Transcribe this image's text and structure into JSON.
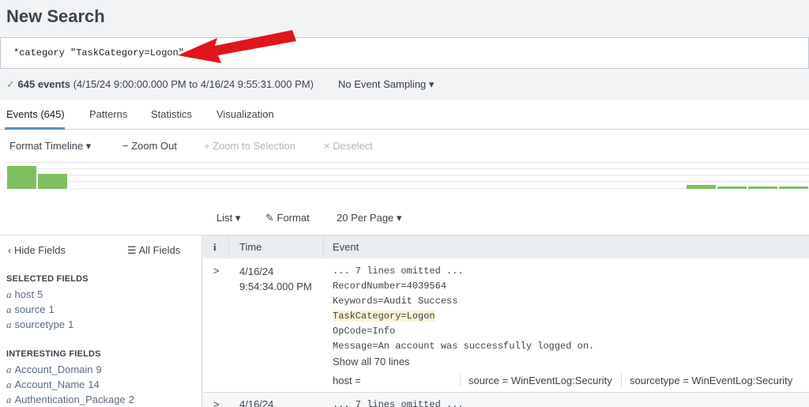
{
  "page": {
    "title": "New Search"
  },
  "search": {
    "query": "*category \"TaskCategory=Logon\""
  },
  "status": {
    "check": "✓",
    "count_label": "645 events",
    "range": "(4/15/24 9:00:00.000 PM to 4/16/24 9:55:31.000 PM)",
    "sampling": "No Event Sampling ▾"
  },
  "tabs": [
    {
      "label": "Events (645)",
      "active": true
    },
    {
      "label": "Patterns"
    },
    {
      "label": "Statistics"
    },
    {
      "label": "Visualization"
    }
  ],
  "timeline": {
    "format": "Format Timeline ▾",
    "zoom_out": "− Zoom Out",
    "zoom_selection": "+ Zoom to Selection",
    "deselect": "× Deselect",
    "bars": [
      0.85,
      0.55,
      0,
      0,
      0,
      0,
      0,
      0,
      0,
      0,
      0,
      0,
      0,
      0,
      0,
      0,
      0,
      0,
      0,
      0,
      0,
      0,
      0.15,
      0.08,
      0.08,
      0.08
    ],
    "bar_color": "#7fc05e"
  },
  "results_toolbar": {
    "list": "List ▾",
    "format": "Format",
    "per_page": "20 Per Page ▾"
  },
  "sidebar": {
    "hide_fields": "Hide Fields",
    "all_fields": "All Fields",
    "selected_heading": "SELECTED FIELDS",
    "selected": [
      {
        "type": "a",
        "name": "host",
        "count": "5"
      },
      {
        "type": "a",
        "name": "source",
        "count": "1"
      },
      {
        "type": "a",
        "name": "sourcetype",
        "count": "1"
      }
    ],
    "interesting_heading": "INTERESTING FIELDS",
    "interesting": [
      {
        "type": "a",
        "name": "Account_Domain",
        "count": "9"
      },
      {
        "type": "a",
        "name": "Account_Name",
        "count": "14"
      },
      {
        "type": "a",
        "name": "Authentication_Package",
        "count": "2"
      }
    ]
  },
  "table": {
    "headers": {
      "info": "i",
      "time": "Time",
      "event": "Event"
    },
    "rows": [
      {
        "expander": ">",
        "date": "4/16/24",
        "time": "9:54:34.000 PM",
        "lines": [
          "... 7 lines omitted ...",
          "RecordNumber=4039564",
          "Keywords=Audit Success",
          "TaskCategory=Logon",
          "OpCode=Info",
          "Message=An account was successfully logged on."
        ],
        "show_all": "Show all 70 lines",
        "host": "host =",
        "source": "source = WinEventLog:Security",
        "sourcetype": "sourcetype = WinEventLog:Security"
      },
      {
        "expander": ">",
        "date": "4/16/24",
        "first_line": "... 7 lines omitted ..."
      }
    ]
  }
}
